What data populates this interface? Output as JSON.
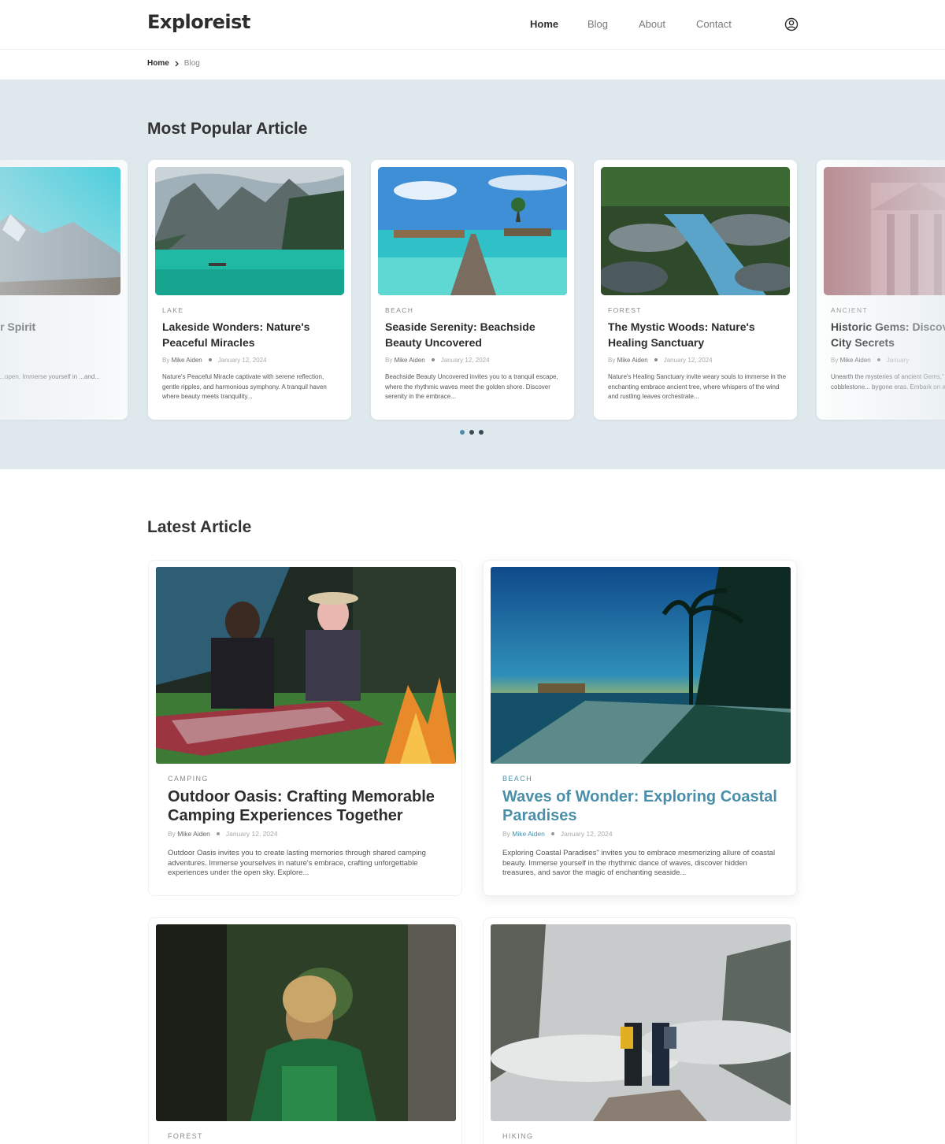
{
  "header": {
    "logo": "Exploreist",
    "nav": [
      {
        "label": "Home",
        "active": true
      },
      {
        "label": "Blog",
        "active": false
      },
      {
        "label": "About",
        "active": false
      },
      {
        "label": "Contact",
        "active": false
      }
    ],
    "user_icon": "user-circle-icon"
  },
  "breadcrumb": {
    "home": "Home",
    "separator_icon": "chevron-right-icon",
    "current": "Blog"
  },
  "popular": {
    "title": "Most Popular Article",
    "cards": [
      {
        "category": "",
        "title": "Elevate Your Spirit",
        "author_prefix": "By",
        "author": "",
        "date": "",
        "excerpt": "...on a transformative ...open. Immerse yourself in ...and..."
      },
      {
        "category": "LAKE",
        "title": "Lakeside Wonders: Nature's Peaceful Miracles",
        "author_prefix": "By",
        "author": "Mike Aiden",
        "date": "January 12, 2024",
        "excerpt": "Nature's Peaceful Miracle captivate with serene reflection, gentle ripples, and harmonious symphony. A tranquil haven where beauty meets tranquility..."
      },
      {
        "category": "BEACH",
        "title": "Seaside Serenity: Beachside Beauty Uncovered",
        "author_prefix": "By",
        "author": "Mike Aiden",
        "date": "January 12, 2024",
        "excerpt": "Beachside Beauty Uncovered invites you to a tranquil escape, where the rhythmic waves meet the golden shore. Discover serenity in the embrace..."
      },
      {
        "category": "FOREST",
        "title": "The Mystic Woods: Nature's Healing Sanctuary",
        "author_prefix": "By",
        "author": "Mike Aiden",
        "date": "January 12, 2024",
        "excerpt": "Nature's Healing Sanctuary invite weary souls to immerse in the enchanting embrace ancient tree, where whispers of the wind and rustling leaves orchestrate..."
      },
      {
        "category": "ANCIENT",
        "title": "Historic Gems: Discover Ancient City Secrets",
        "author_prefix": "By",
        "author": "Mike Aiden",
        "date": "January",
        "excerpt": "Unearth the mysteries of ancient Gems,\" where each cobblestone... bygone eras. Embark on a journey..."
      }
    ],
    "pagination": [
      "slide-1",
      "slide-2",
      "slide-3"
    ]
  },
  "latest": {
    "title": "Latest Article",
    "cards": [
      {
        "category": "CAMPING",
        "title": "Outdoor Oasis: Crafting Memorable Camping Experiences Together",
        "author_prefix": "By",
        "author": "Mike Aiden",
        "date": "January 12, 2024",
        "excerpt": "Outdoor Oasis invites you to create lasting memories through shared camping adventures. Immerse yourselves in nature's embrace, crafting unforgettable experiences under the open sky. Explore..."
      },
      {
        "category": "BEACH",
        "title": "Waves of Wonder: Exploring Coastal Paradises",
        "author_prefix": "By",
        "author": "Mike Aiden",
        "date": "January 12, 2024",
        "excerpt": "Exploring Coastal Paradises\" invites you to embrace mesmerizing allure of coastal beauty. Immerse yourself in the rhythmic dance of waves, discover hidden treasures, and savor the magic of enchanting seaside..."
      },
      {
        "category": "FOREST",
        "title": "",
        "author_prefix": "",
        "author": "",
        "date": "",
        "excerpt": ""
      },
      {
        "category": "HIKING",
        "title": "",
        "author_prefix": "",
        "author": "",
        "date": "",
        "excerpt": ""
      }
    ]
  },
  "colors": {
    "accent": "#4a8fa8",
    "popular_bg": "#dfe8ed",
    "text_dark": "#2d2d2d"
  }
}
